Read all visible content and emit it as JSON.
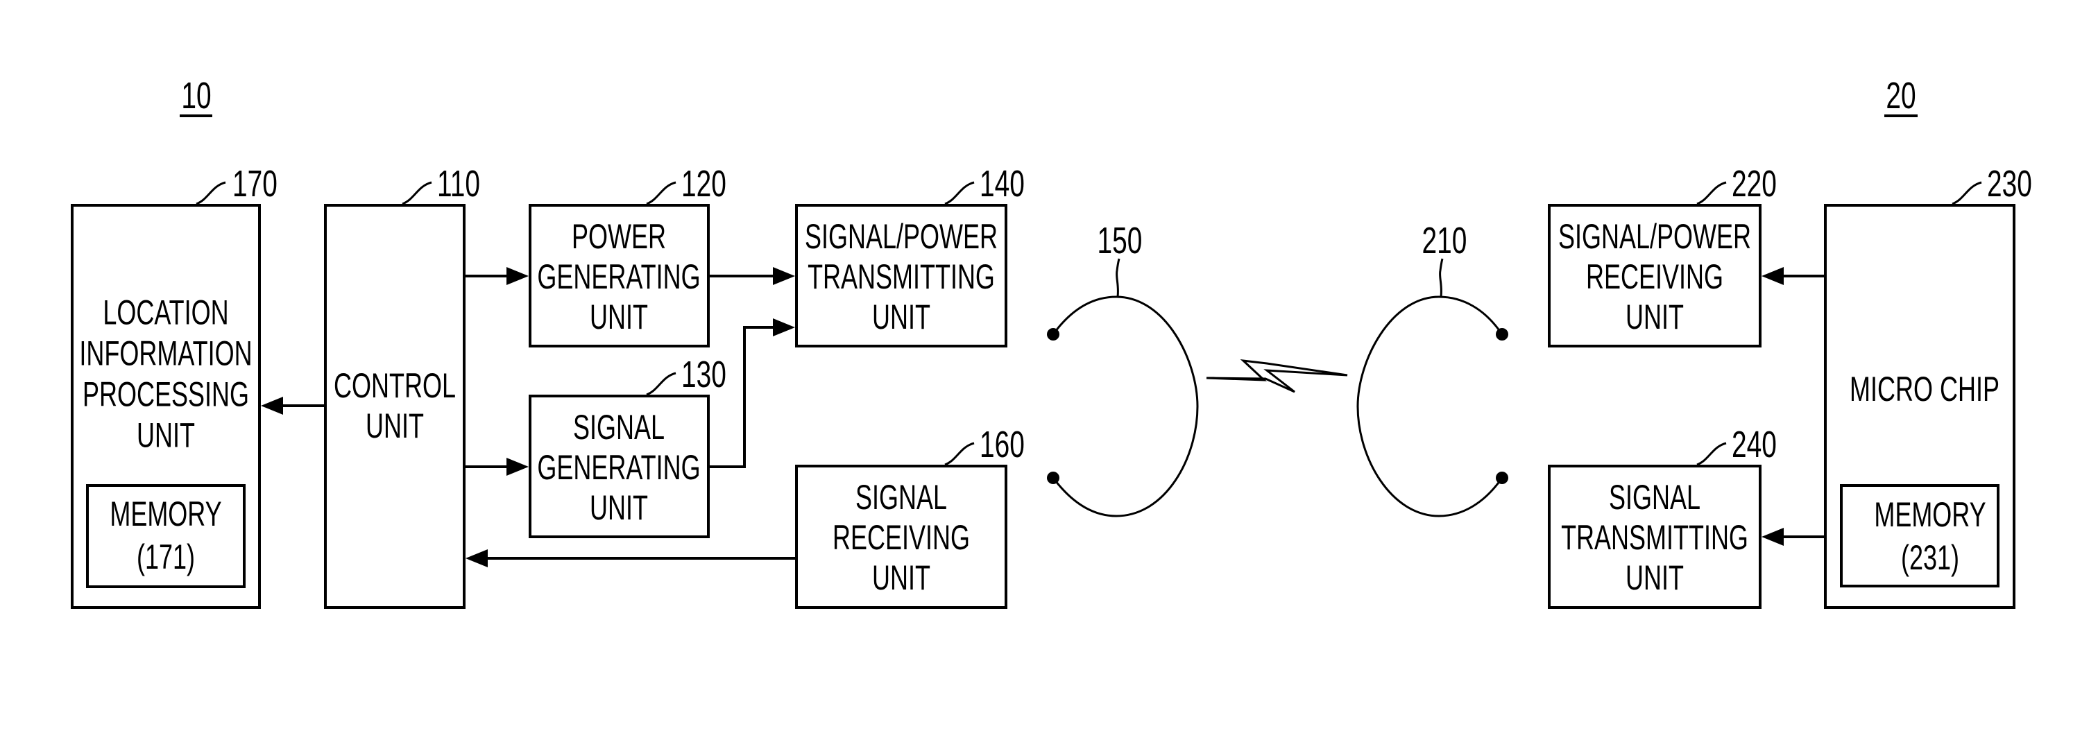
{
  "figure": {
    "left_device": {
      "ref": "10",
      "blocks": {
        "location_unit": {
          "ref": "170",
          "lines": [
            "LOCATION",
            "INFORMATION",
            "PROCESSING",
            "UNIT"
          ],
          "memory": {
            "lines": [
              "MEMORY",
              "(171)"
            ]
          }
        },
        "control_unit": {
          "ref": "110",
          "lines": [
            "CONTROL",
            "UNIT"
          ]
        },
        "power_generating_unit": {
          "ref": "120",
          "lines": [
            "POWER",
            "GENERATING",
            "UNIT"
          ]
        },
        "signal_generating_unit": {
          "ref": "130",
          "lines": [
            "SIGNAL",
            "GENERATING",
            "UNIT"
          ]
        },
        "signal_power_transmitting_unit": {
          "ref": "140",
          "lines": [
            "SIGNAL/POWER",
            "TRANSMITTING",
            "UNIT"
          ]
        },
        "signal_receiving_unit": {
          "ref": "160",
          "lines": [
            "SIGNAL",
            "RECEIVING",
            "UNIT"
          ]
        }
      },
      "coil": {
        "ref": "150"
      }
    },
    "right_device": {
      "ref": "20",
      "blocks": {
        "signal_power_receiving_unit": {
          "ref": "220",
          "lines": [
            "SIGNAL/POWER",
            "RECEIVING",
            "UNIT"
          ]
        },
        "micro_chip": {
          "ref": "230",
          "lines": [
            "MICRO CHIP"
          ],
          "memory": {
            "lines": [
              "MEMORY",
              "(231)"
            ]
          }
        },
        "signal_transmitting_unit": {
          "ref": "240",
          "lines": [
            "SIGNAL",
            "TRANSMITTING",
            "UNIT"
          ]
        }
      },
      "coil": {
        "ref": "210"
      }
    },
    "connections": [
      {
        "from": "control_unit",
        "to": "location_unit"
      },
      {
        "from": "control_unit",
        "to": "power_generating_unit"
      },
      {
        "from": "control_unit",
        "to": "signal_generating_unit"
      },
      {
        "from": "power_generating_unit",
        "to": "signal_power_transmitting_unit"
      },
      {
        "from": "signal_generating_unit",
        "to": "signal_power_transmitting_unit"
      },
      {
        "from": "signal_receiving_unit",
        "to": "control_unit"
      },
      {
        "from": "micro_chip",
        "to": "signal_power_receiving_unit"
      },
      {
        "from": "micro_chip",
        "to": "signal_transmitting_unit"
      },
      {
        "from": "coil_150",
        "to": "coil_210",
        "type": "wireless"
      }
    ]
  }
}
